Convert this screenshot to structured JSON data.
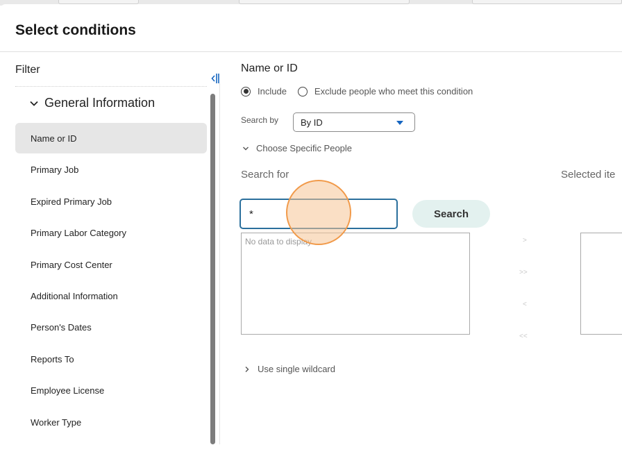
{
  "dialog": {
    "title": "Select conditions"
  },
  "sidebar": {
    "filter_label": "Filter",
    "group_label": "General Information",
    "items": [
      {
        "label": "Name or ID",
        "active": true
      },
      {
        "label": "Primary Job"
      },
      {
        "label": "Expired Primary Job"
      },
      {
        "label": "Primary Labor Category"
      },
      {
        "label": "Primary Cost Center"
      },
      {
        "label": "Additional Information"
      },
      {
        "label": "Person's Dates"
      },
      {
        "label": "Reports To"
      },
      {
        "label": "Employee License"
      },
      {
        "label": "Worker Type"
      }
    ]
  },
  "main": {
    "title": "Name or ID",
    "include_label": "Include",
    "exclude_label": "Exclude people who meet this condition",
    "search_by_label": "Search by",
    "search_by_value": "By ID",
    "choose_specific_label": "Choose Specific People",
    "search_for_label": "Search for",
    "selected_items_label": "Selected ite",
    "search_input_value": "*",
    "search_button_label": "Search",
    "no_data_label": "No data to display",
    "transfer_buttons": [
      ">",
      ">>",
      "<",
      "<<"
    ],
    "wildcard_label": "Use single wildcard"
  },
  "colors": {
    "input_focus_border": "#2a6f9c",
    "search_button_bg": "#e3f1ef",
    "select_caret": "#1565c0",
    "active_item_bg": "#e6e6e6",
    "click_indicator": "#f19a4a"
  }
}
